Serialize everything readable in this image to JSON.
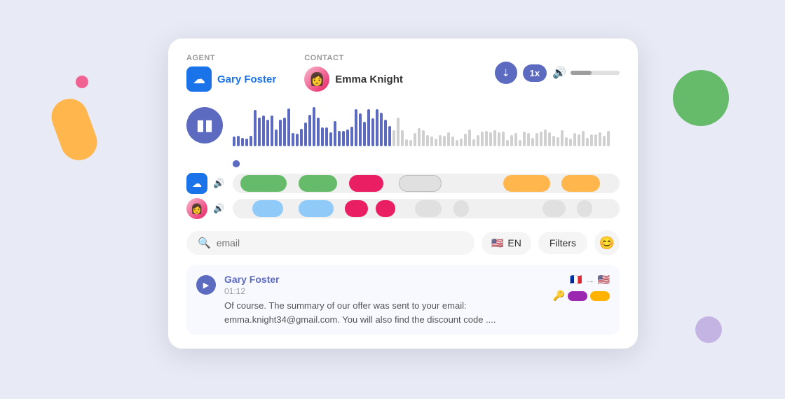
{
  "background": {
    "color": "#e8eaf6"
  },
  "card": {
    "agent_label": "AGENT",
    "contact_label": "CONTACT",
    "agent_name": "Gary Foster",
    "contact_name": "Emma Knight",
    "speed_label": "1x",
    "lang_label": "EN",
    "filters_label": "Filters",
    "search_placeholder": "email",
    "transcript": {
      "speaker": "Gary Foster",
      "time": "01:12",
      "text": "Of course. The summary of our offer was sent to your email: emma.knight34@gmail.com. You will also find the discount code ...."
    }
  }
}
